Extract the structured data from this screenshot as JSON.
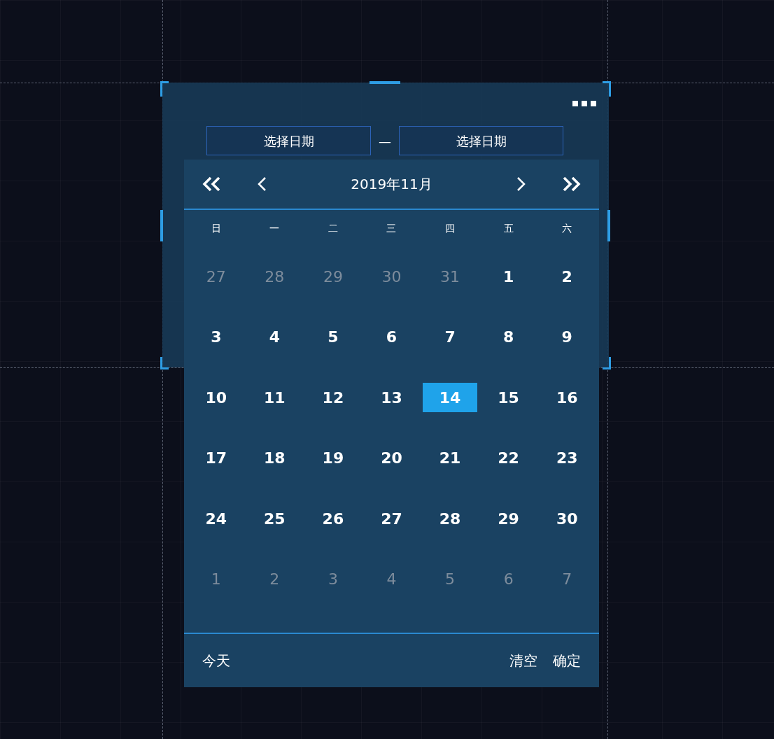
{
  "range_inputs": [
    {
      "placeholder": "选择日期"
    },
    {
      "placeholder": "选择日期"
    }
  ],
  "range_separator": "—",
  "calendar": {
    "title": "2019年11月",
    "weekdays": [
      "日",
      "一",
      "二",
      "三",
      "四",
      "五",
      "六"
    ],
    "days": [
      {
        "text": "27",
        "muted": true,
        "selected": false
      },
      {
        "text": "28",
        "muted": true,
        "selected": false
      },
      {
        "text": "29",
        "muted": true,
        "selected": false
      },
      {
        "text": "30",
        "muted": true,
        "selected": false
      },
      {
        "text": "31",
        "muted": true,
        "selected": false
      },
      {
        "text": "1",
        "muted": false,
        "selected": false
      },
      {
        "text": "2",
        "muted": false,
        "selected": false
      },
      {
        "text": "3",
        "muted": false,
        "selected": false
      },
      {
        "text": "4",
        "muted": false,
        "selected": false
      },
      {
        "text": "5",
        "muted": false,
        "selected": false
      },
      {
        "text": "6",
        "muted": false,
        "selected": false
      },
      {
        "text": "7",
        "muted": false,
        "selected": false
      },
      {
        "text": "8",
        "muted": false,
        "selected": false
      },
      {
        "text": "9",
        "muted": false,
        "selected": false
      },
      {
        "text": "10",
        "muted": false,
        "selected": false
      },
      {
        "text": "11",
        "muted": false,
        "selected": false
      },
      {
        "text": "12",
        "muted": false,
        "selected": false
      },
      {
        "text": "13",
        "muted": false,
        "selected": false
      },
      {
        "text": "14",
        "muted": false,
        "selected": true
      },
      {
        "text": "15",
        "muted": false,
        "selected": false
      },
      {
        "text": "16",
        "muted": false,
        "selected": false
      },
      {
        "text": "17",
        "muted": false,
        "selected": false
      },
      {
        "text": "18",
        "muted": false,
        "selected": false
      },
      {
        "text": "19",
        "muted": false,
        "selected": false
      },
      {
        "text": "20",
        "muted": false,
        "selected": false
      },
      {
        "text": "21",
        "muted": false,
        "selected": false
      },
      {
        "text": "22",
        "muted": false,
        "selected": false
      },
      {
        "text": "23",
        "muted": false,
        "selected": false
      },
      {
        "text": "24",
        "muted": false,
        "selected": false
      },
      {
        "text": "25",
        "muted": false,
        "selected": false
      },
      {
        "text": "26",
        "muted": false,
        "selected": false
      },
      {
        "text": "27",
        "muted": false,
        "selected": false
      },
      {
        "text": "28",
        "muted": false,
        "selected": false
      },
      {
        "text": "29",
        "muted": false,
        "selected": false
      },
      {
        "text": "30",
        "muted": false,
        "selected": false
      },
      {
        "text": "1",
        "muted": true,
        "selected": false
      },
      {
        "text": "2",
        "muted": true,
        "selected": false
      },
      {
        "text": "3",
        "muted": true,
        "selected": false
      },
      {
        "text": "4",
        "muted": true,
        "selected": false
      },
      {
        "text": "5",
        "muted": true,
        "selected": false
      },
      {
        "text": "6",
        "muted": true,
        "selected": false
      },
      {
        "text": "7",
        "muted": true,
        "selected": false
      }
    ],
    "footer": {
      "today": "今天",
      "actions": [
        "清空",
        "确定"
      ]
    }
  }
}
